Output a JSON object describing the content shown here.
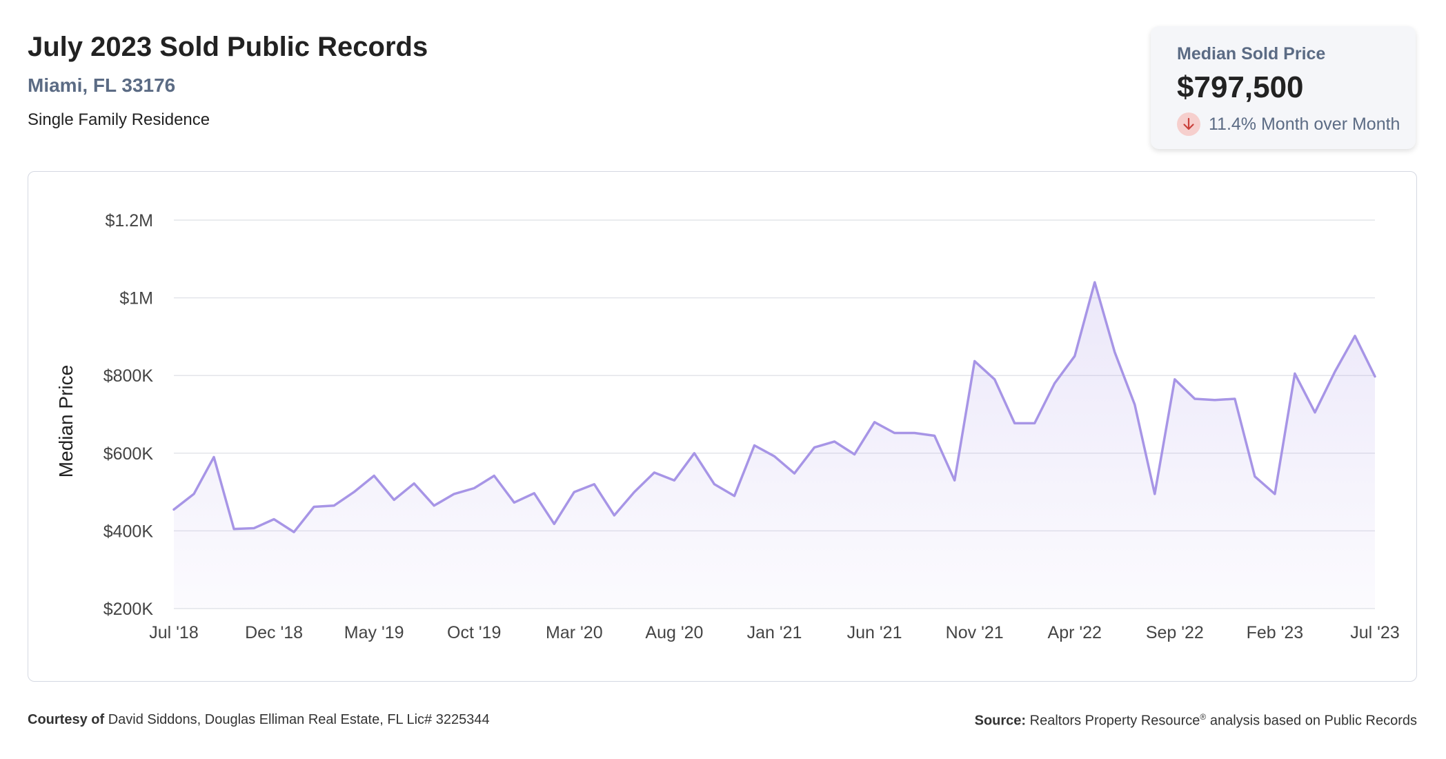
{
  "header": {
    "title": "July 2023 Sold Public Records",
    "location": "Miami, FL 33176",
    "property_type": "Single Family Residence"
  },
  "stat_card": {
    "label": "Median Sold Price",
    "value": "$797,500",
    "change_text": "11.4% Month over Month",
    "direction": "down",
    "down_color": "#c9403a",
    "down_bg": "#f6cfcd"
  },
  "chart_data": {
    "type": "area",
    "ylabel": "Median Price",
    "ylim": [
      200000,
      1200000
    ],
    "y_ticks": [
      {
        "value": 200000,
        "label": "$200K"
      },
      {
        "value": 400000,
        "label": "$400K"
      },
      {
        "value": 600000,
        "label": "$600K"
      },
      {
        "value": 800000,
        "label": "$800K"
      },
      {
        "value": 1000000,
        "label": "$1M"
      },
      {
        "value": 1200000,
        "label": "$1.2M"
      }
    ],
    "x_ticks": [
      {
        "index": 0,
        "label": "Jul '18"
      },
      {
        "index": 5,
        "label": "Dec '18"
      },
      {
        "index": 10,
        "label": "May '19"
      },
      {
        "index": 15,
        "label": "Oct '19"
      },
      {
        "index": 20,
        "label": "Mar '20"
      },
      {
        "index": 25,
        "label": "Aug '20"
      },
      {
        "index": 30,
        "label": "Jan '21"
      },
      {
        "index": 35,
        "label": "Jun '21"
      },
      {
        "index": 40,
        "label": "Nov '21"
      },
      {
        "index": 45,
        "label": "Apr '22"
      },
      {
        "index": 50,
        "label": "Sep '22"
      },
      {
        "index": 55,
        "label": "Feb '23"
      },
      {
        "index": 60,
        "label": "Jul '23"
      }
    ],
    "x": [
      "Jul '18",
      "Aug '18",
      "Sep '18",
      "Oct '18",
      "Nov '18",
      "Dec '18",
      "Jan '19",
      "Feb '19",
      "Mar '19",
      "Apr '19",
      "May '19",
      "Jun '19",
      "Jul '19",
      "Aug '19",
      "Sep '19",
      "Oct '19",
      "Nov '19",
      "Dec '19",
      "Jan '20",
      "Feb '20",
      "Mar '20",
      "Apr '20",
      "May '20",
      "Jun '20",
      "Jul '20",
      "Aug '20",
      "Sep '20",
      "Oct '20",
      "Nov '20",
      "Dec '20",
      "Jan '21",
      "Feb '21",
      "Mar '21",
      "Apr '21",
      "May '21",
      "Jun '21",
      "Jul '21",
      "Aug '21",
      "Sep '21",
      "Oct '21",
      "Nov '21",
      "Dec '21",
      "Jan '22",
      "Feb '22",
      "Mar '22",
      "Apr '22",
      "May '22",
      "Jun '22",
      "Jul '22",
      "Aug '22",
      "Sep '22",
      "Oct '22",
      "Nov '22",
      "Dec '22",
      "Jan '23",
      "Feb '23",
      "Mar '23",
      "Apr '23",
      "May '23",
      "Jun '23",
      "Jul '23"
    ],
    "values": [
      455000,
      495000,
      590000,
      405000,
      407000,
      430000,
      397000,
      462000,
      465000,
      500000,
      542000,
      480000,
      522000,
      465000,
      495000,
      510000,
      542000,
      473000,
      497000,
      418000,
      500000,
      520000,
      440000,
      500000,
      550000,
      530000,
      600000,
      520000,
      490000,
      620000,
      592000,
      548000,
      615000,
      630000,
      597000,
      680000,
      652000,
      652000,
      645000,
      530000,
      837000,
      790000,
      677000,
      677000,
      780000,
      850000,
      1040000,
      860000,
      725000,
      495000,
      790000,
      740000,
      737000,
      740000,
      540000,
      495000,
      805000,
      705000,
      810000,
      902000,
      797500
    ],
    "line_color": "#a795e6",
    "fill_color": "#f4f1fc",
    "grid": true
  },
  "footer": {
    "courtesy_label": "Courtesy of",
    "courtesy_text": "David Siddons, Douglas Elliman Real Estate, FL Lic# 3225344",
    "source_label": "Source:",
    "source_name": "Realtors Property Resource",
    "source_mark": "®",
    "source_text": "analysis based on Public Records"
  }
}
